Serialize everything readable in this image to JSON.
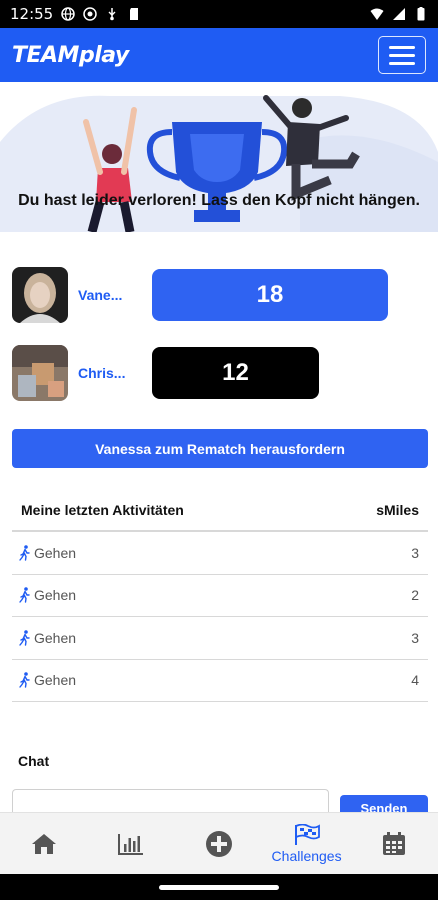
{
  "status_bar": {
    "time": "12:55",
    "icons_left": [
      "globe-icon",
      "settings-icon",
      "usb-icon",
      "sd-card-icon"
    ],
    "icons_right": [
      "wifi-icon",
      "signal-icon",
      "battery-icon"
    ]
  },
  "app": {
    "logo_team": "TEAM",
    "logo_play": "play",
    "accent_color": "#1f5cf3"
  },
  "result": {
    "message": "Du hast leider verloren! Lass den Kopf nicht hängen."
  },
  "players": [
    {
      "name": "Vane...",
      "score": "18",
      "score_color": "#2f63f2"
    },
    {
      "name": "Chris...",
      "score": "12",
      "score_color": "#000000"
    }
  ],
  "rematch_button": "Vanessa zum Rematch herausfordern",
  "activities": {
    "header_left": "Meine letzten Aktivitäten",
    "header_right": "sMiles",
    "rows": [
      {
        "icon": "walking-icon",
        "label": "Gehen",
        "value": "3"
      },
      {
        "icon": "walking-icon",
        "label": "Gehen",
        "value": "2"
      },
      {
        "icon": "walking-icon",
        "label": "Gehen",
        "value": "3"
      },
      {
        "icon": "walking-icon",
        "label": "Gehen",
        "value": "4"
      }
    ]
  },
  "chat": {
    "label": "Chat",
    "send_label": "Senden"
  },
  "bottom_nav": [
    {
      "icon": "home-icon",
      "label": ""
    },
    {
      "icon": "bar-chart-icon",
      "label": ""
    },
    {
      "icon": "plus-circle-icon",
      "label": ""
    },
    {
      "icon": "flag-icon",
      "label": "Challenges",
      "active": true
    },
    {
      "icon": "calendar-icon",
      "label": ""
    }
  ]
}
